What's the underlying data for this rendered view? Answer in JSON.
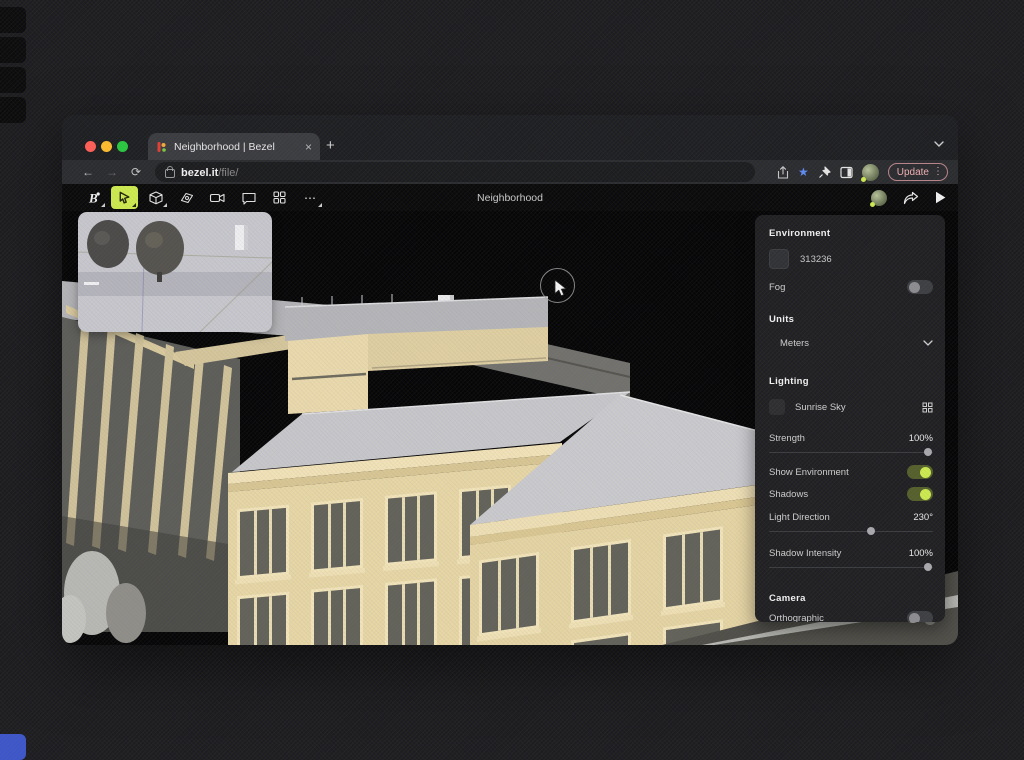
{
  "colors": {
    "accent_lime": "#cdea50",
    "toggle_on_knob": "#cdea50",
    "environment_swatch": "#313236",
    "update_pill_text": "#f0b0b4",
    "bookmark_star": "#5e8bf5"
  },
  "browser": {
    "tab_title": "Neighborhood | Bezel",
    "close_glyph": "×",
    "new_tab_glyph": "+",
    "url_domain": "bezel.it",
    "url_path": "/file/",
    "update_label": "Update",
    "kebab_glyph": "⋮"
  },
  "app": {
    "title": "Neighborhood",
    "more_tool_glyph": "⋯"
  },
  "panel": {
    "environment": {
      "header": "Environment",
      "color_hex": "313236",
      "fog": {
        "label": "Fog",
        "on": false
      }
    },
    "units": {
      "header": "Units",
      "selected": "Meters"
    },
    "lighting": {
      "header": "Lighting",
      "sky_preset": "Sunrise Sky",
      "strength": {
        "label": "Strength",
        "value": "100%",
        "pct": 97
      },
      "show_environment": {
        "label": "Show Environment",
        "on": true
      },
      "shadows": {
        "label": "Shadows",
        "on": true
      },
      "light_direction": {
        "label": "Light Direction",
        "value": "230°",
        "pct": 62
      },
      "shadow_intensity": {
        "label": "Shadow Intensity",
        "value": "100%",
        "pct": 97
      }
    },
    "camera": {
      "header": "Camera",
      "orthographic": {
        "label": "Orthographic",
        "on": false
      }
    }
  }
}
